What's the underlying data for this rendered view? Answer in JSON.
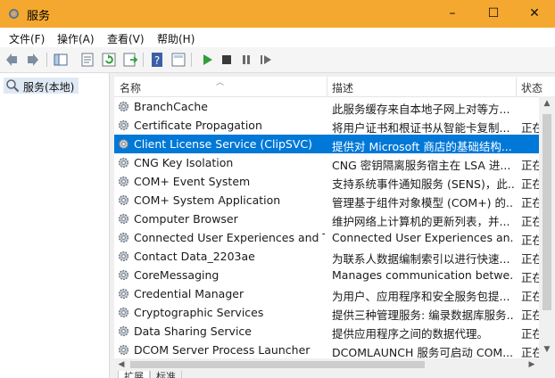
{
  "window": {
    "title": "服务",
    "controls": {
      "minimize": "–",
      "maximize": "☐",
      "close": "✕"
    }
  },
  "menu": [
    "文件(F)",
    "操作(A)",
    "查看(V)",
    "帮助(H)"
  ],
  "toolbar": {
    "icons": [
      "back-arrow-icon",
      "forward-arrow-icon",
      "console-tree-icon",
      "properties-icon",
      "refresh-icon",
      "export-list-icon",
      "help-icon",
      "show-hide-icon",
      "start-service-icon",
      "stop-service-icon",
      "pause-service-icon",
      "restart-service-icon"
    ]
  },
  "tree": {
    "root_label": "服务(本地)"
  },
  "list": {
    "columns": {
      "name": "名称",
      "description": "描述",
      "status": "状态"
    },
    "rows": [
      {
        "name": "BranchCache",
        "description": "此服务缓存来自本地子网上对等方...",
        "status": ""
      },
      {
        "name": "Certificate Propagation",
        "description": "将用户证书和根证书从智能卡复制...",
        "status": "正在"
      },
      {
        "name": "Client License Service (ClipSVC)",
        "description": "提供对 Microsoft 商店的基础结构...",
        "status": ""
      },
      {
        "name": "CNG Key Isolation",
        "description": "CNG 密钥隔离服务宿主在 LSA 进...",
        "status": "正在"
      },
      {
        "name": "COM+ Event System",
        "description": "支持系统事件通知服务 (SENS)，此...",
        "status": "正在"
      },
      {
        "name": "COM+ System Application",
        "description": "管理基于组件对象模型 (COM+) 的...",
        "status": "正在"
      },
      {
        "name": "Computer Browser",
        "description": "维护网络上计算机的更新列表，并...",
        "status": "正在"
      },
      {
        "name": "Connected User Experiences and T...",
        "description": "Connected User Experiences an...",
        "status": "正在"
      },
      {
        "name": "Contact Data_2203ae",
        "description": "为联系人数据编制索引以进行快速...",
        "status": "正在"
      },
      {
        "name": "CoreMessaging",
        "description": "Manages communication betwe...",
        "status": "正在"
      },
      {
        "name": "Credential Manager",
        "description": "为用户、应用程序和安全服务包提...",
        "status": "正在"
      },
      {
        "name": "Cryptographic Services",
        "description": "提供三种管理服务: 编录数据库服务...",
        "status": "正在"
      },
      {
        "name": "Data Sharing Service",
        "description": "提供应用程序之间的数据代理。",
        "status": "正在"
      },
      {
        "name": "DCOM Server Process Launcher",
        "description": "DCOMLAUNCH 服务可启动 COM...",
        "status": "正在"
      }
    ],
    "selected_index": 2
  },
  "bottom_tabs": [
    "扩展",
    "标准"
  ],
  "colors": {
    "titlebar": "#f4a830",
    "selection": "#0078d7"
  }
}
